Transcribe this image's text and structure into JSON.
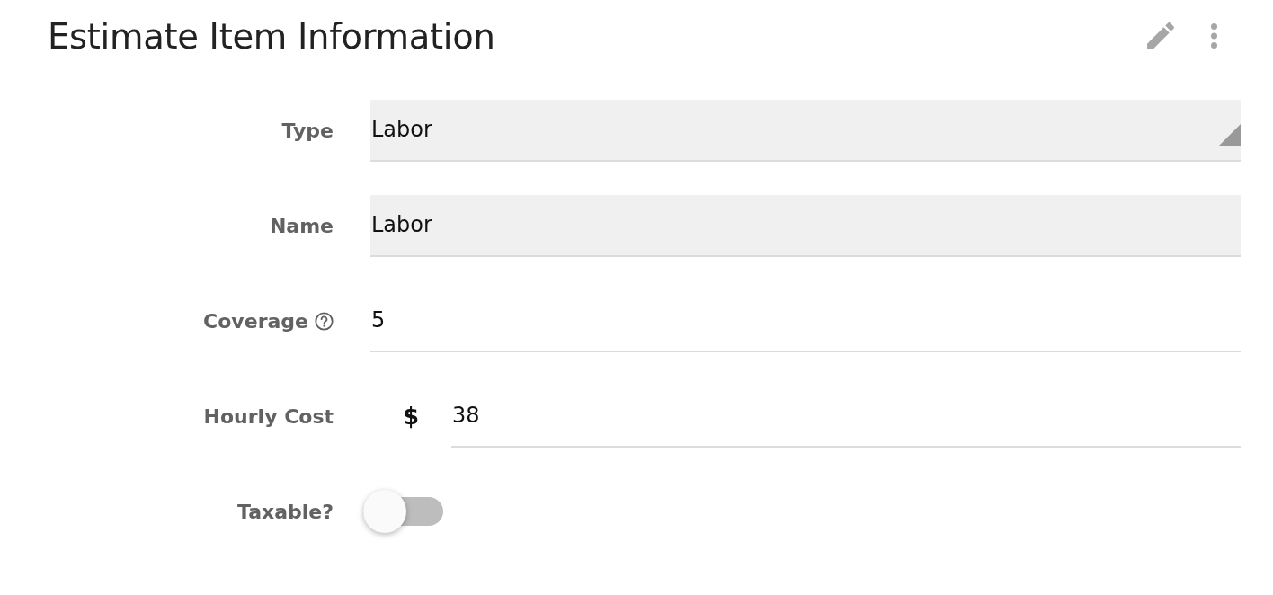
{
  "card": {
    "title": "Estimate Item Information"
  },
  "fields": [
    {
      "kind": "dropdown",
      "label": "Type",
      "value": "Labor",
      "help": false
    },
    {
      "kind": "filled",
      "label": "Name",
      "value": "Labor",
      "help": false
    },
    {
      "kind": "underlined",
      "label": "Coverage",
      "value": "5",
      "help": true
    },
    {
      "kind": "currency",
      "label": "Hourly Cost",
      "prefix": "$",
      "value": "38",
      "help": false
    },
    {
      "kind": "toggle",
      "label": "Taxable?",
      "on": false,
      "help": false
    }
  ]
}
